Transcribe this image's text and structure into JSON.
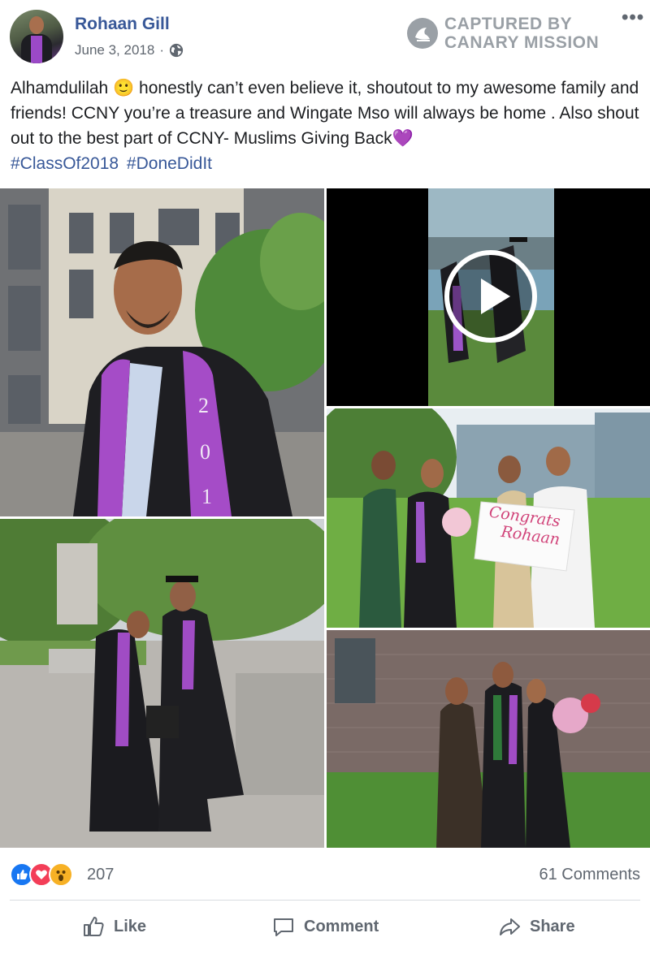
{
  "post": {
    "author": "Rohaan Gill",
    "date": "June 3, 2018",
    "meta_sep": "·",
    "text": "Alhamdulilah 🙂 honestly can’t even believe it, shoutout to my awesome family and friends! CCNY you’re a treasure and Wingate Mso will always be home . Also shout out to the best part of CCNY- Muslims Giving Back💜",
    "hashtags": [
      "#ClassOf2018",
      "#DoneDidIt"
    ]
  },
  "watermark": {
    "line1": "CAPTURED BY",
    "line2": "CANARY MISSION"
  },
  "photos": {
    "stole_digits": [
      "2",
      "0",
      "1"
    ],
    "sign_line1": "Congrats",
    "sign_line2": "Rohaan"
  },
  "footer": {
    "reaction_count": "207",
    "comments": "61 Comments",
    "like_label": "Like",
    "comment_label": "Comment",
    "share_label": "Share"
  },
  "colors": {
    "link_blue": "#385898",
    "meta_gray": "#606770",
    "like_blue": "#1877f2",
    "love_red": "#f33e58",
    "wow_yellow": "#f7b125"
  },
  "icons": [
    "globe-icon",
    "canary-mission-logo-icon",
    "more-icon",
    "play-icon",
    "like-icon",
    "comment-icon",
    "share-icon"
  ]
}
